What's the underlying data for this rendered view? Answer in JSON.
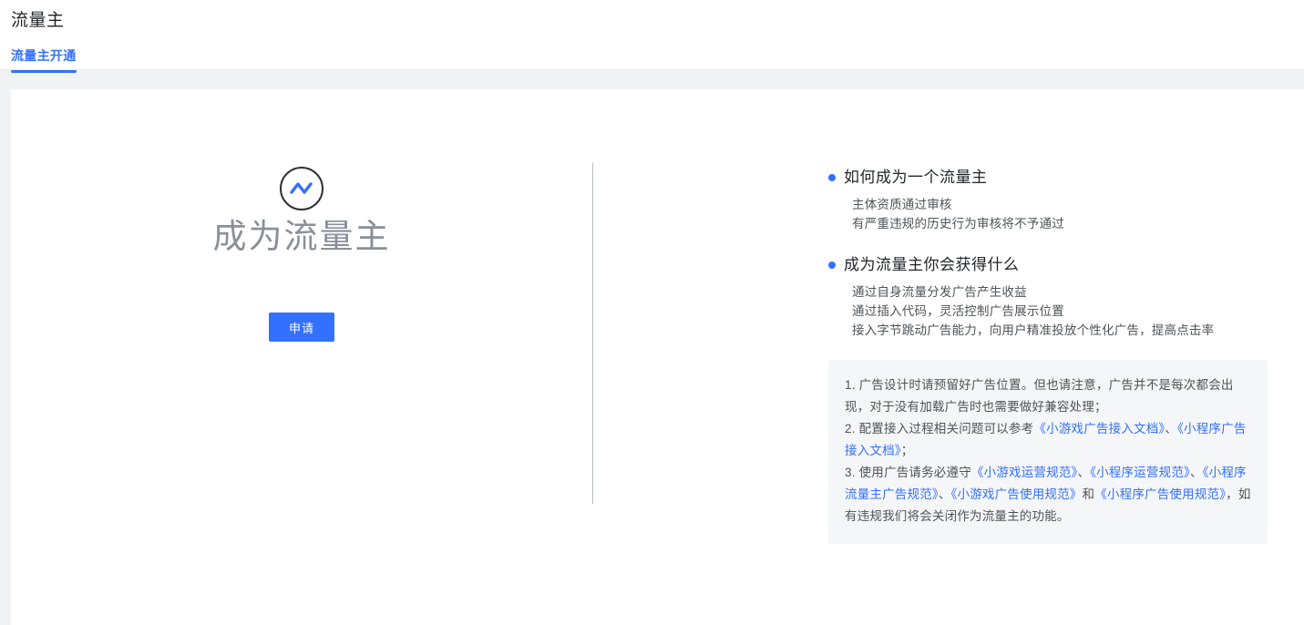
{
  "header": {
    "title": "流量主",
    "tabs": [
      {
        "label": "流量主开通",
        "active": true
      }
    ]
  },
  "hero": {
    "icon": "wave-circle-icon",
    "title": "成为流量主",
    "apply_label": "申请"
  },
  "info_sections": [
    {
      "heading": "如何成为一个流量主",
      "lines": [
        "主体资质通过审核",
        "有严重违规的历史行为审核将不予通过"
      ]
    },
    {
      "heading": "成为流量主你会获得什么",
      "lines": [
        "通过自身流量分发广告产生收益",
        "通过插入代码，灵活控制广告展示位置",
        "接入字节跳动广告能力，向用户精准投放个性化广告，提高点击率"
      ]
    }
  ],
  "notes": [
    {
      "parts": [
        {
          "type": "text",
          "value": "1. 广告设计时请预留好广告位置。但也请注意，广告并不是每次都会出现，对于没有加载广告时也需要做好兼容处理；"
        }
      ]
    },
    {
      "parts": [
        {
          "type": "text",
          "value": "2. 配置接入过程相关问题可以参考"
        },
        {
          "type": "link",
          "value": "《小游戏广告接入文档》"
        },
        {
          "type": "text",
          "value": "、"
        },
        {
          "type": "link",
          "value": "《小程序广告接入文档》"
        },
        {
          "type": "text",
          "value": "；"
        }
      ]
    },
    {
      "parts": [
        {
          "type": "text",
          "value": "3. 使用广告请务必遵守"
        },
        {
          "type": "link",
          "value": "《小游戏运营规范》"
        },
        {
          "type": "text",
          "value": "、"
        },
        {
          "type": "link",
          "value": "《小程序运营规范》"
        },
        {
          "type": "text",
          "value": "、"
        },
        {
          "type": "link",
          "value": "《小程序流量主广告规范》"
        },
        {
          "type": "text",
          "value": "、"
        },
        {
          "type": "link",
          "value": "《小游戏广告使用规范》"
        },
        {
          "type": "text",
          "value": "和"
        },
        {
          "type": "link",
          "value": "《小程序广告使用规范》"
        },
        {
          "type": "text",
          "value": "，如有违规我们将会关闭作为流量主的功能。"
        }
      ]
    }
  ],
  "colors": {
    "accent": "#3370ff",
    "page_bg": "#f2f3f5",
    "card_bg": "#ffffff",
    "note_bg": "#f5f6f7",
    "body_text": "#4e5358",
    "heading_text": "#1f2329",
    "hero_title": "#8a9099",
    "divider": "#b8bcc2"
  }
}
